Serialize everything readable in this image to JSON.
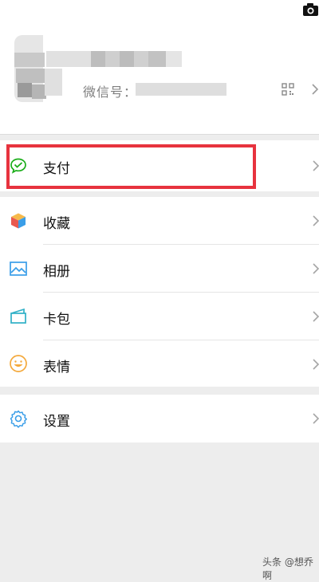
{
  "profile": {
    "wechat_id_label": "微信号：",
    "wechat_id_value": "",
    "name": ""
  },
  "menu": {
    "pay": {
      "label": "支付",
      "icon": "wechat-pay-icon"
    },
    "favorites": {
      "label": "收藏",
      "icon": "cube-icon"
    },
    "album": {
      "label": "相册",
      "icon": "photo-album-icon"
    },
    "cards": {
      "label": "卡包",
      "icon": "card-wallet-icon"
    },
    "stickers": {
      "label": "表情",
      "icon": "smiley-icon"
    },
    "settings": {
      "label": "设置",
      "icon": "gear-icon"
    }
  },
  "highlight_color": "#e7333e",
  "watermark": "头条 @想乔啊"
}
